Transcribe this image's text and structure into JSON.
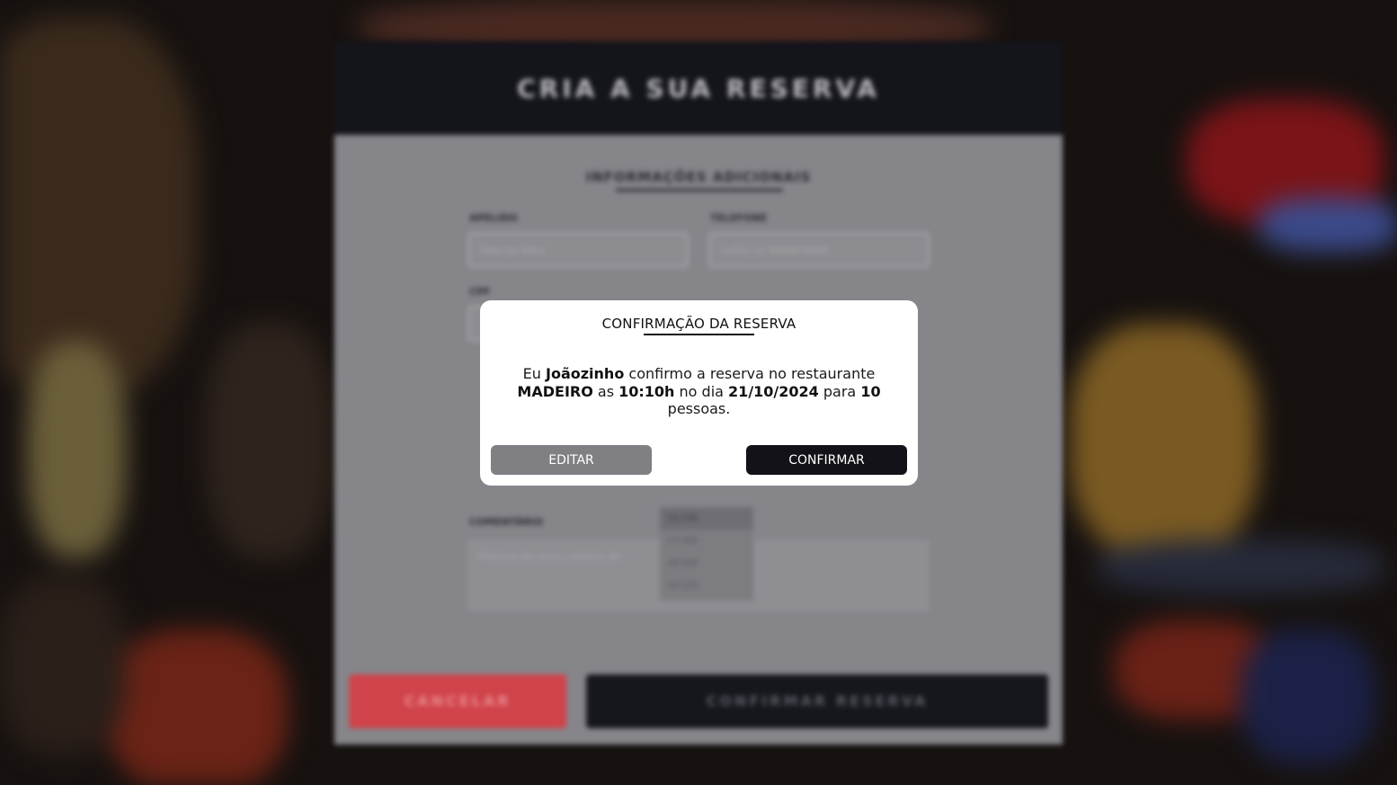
{
  "background_panel": {
    "title": "CRIA A SUA RESERVA",
    "section_title": "INFORMAÇÕES ADICIONAIS",
    "fields": {
      "apelido": {
        "label": "APELIDO",
        "placeholder": "Sem de Silva"
      },
      "telefone": {
        "label": "TELEFONE",
        "placeholder": "(+55) 11 00000-0000"
      },
      "cpf": {
        "label": "CPF"
      },
      "comentario": {
        "label": "COMENTÁRIO",
        "placeholder": "Precisa de uma cadeira de"
      }
    },
    "time_options": [
      "10:10h",
      "17:40h",
      "18:20h",
      "19:10h"
    ],
    "cancel_label": "CANCELAR",
    "confirm_reservation_label": "CONFIRMAR RESERVA"
  },
  "modal": {
    "title": "CONFIRMAÇÃO DA RESERVA",
    "msg": {
      "p1": "Eu ",
      "name": "Joãozinho",
      "p2": " confirmo a reserva no restaurante ",
      "restaurant": "MADEIRO",
      "p3": " as ",
      "time": "10:10h",
      "p4": " no dia ",
      "date": "21/10/2024",
      "p5": " para ",
      "people": "10",
      "p6": " pessoas."
    },
    "edit_label": "EDITAR",
    "confirm_label": "CONFIRMAR"
  }
}
